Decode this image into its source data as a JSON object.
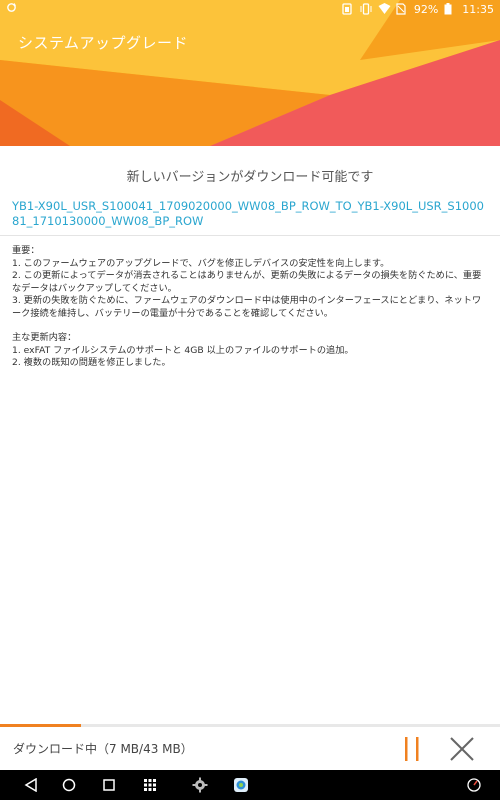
{
  "status_bar": {
    "battery_percent": "92%",
    "time": "11:35",
    "icons": [
      "sync-icon",
      "battery-saver-icon",
      "vibrate-icon",
      "wifi-icon",
      "no-sim-icon",
      "battery-icon"
    ]
  },
  "header": {
    "title": "システムアップグレード",
    "colors": {
      "orange": "#f7941d",
      "yellow": "#fdb813",
      "pink": "#f15a5a",
      "dark_orange": "#f06a22"
    }
  },
  "content": {
    "headline": "新しいバージョンがダウンロード可能です",
    "version_name": "YB1-X90L_USR_S100041_1709020000_WW08_BP_ROW_TO_YB1-X90L_USR_S100081_1710130000_WW08_BP_ROW",
    "notes": {
      "important_title": "重要：",
      "important_items": [
        "1. このファームウェアのアップグレードで、バグを修正しデバイスの安定性を向上します。",
        "2. この更新によってデータが消去されることはありませんが、更新の失敗によるデータの損失を防ぐために、重要なデータはバックアップしてください。",
        "3. 更新の失敗を防ぐために、ファームウェアのダウンロード中は使用中のインターフェースにとどまり、ネットワーク接続を維持し、バッテリーの電量が十分であることを確認してください。"
      ],
      "updates_title": "主な更新内容：",
      "update_items": [
        "1. exFAT ファイルシステムのサポートと 4GB 以上のファイルのサポートの追加。",
        "2. 複数の既知の問題を修正しました。"
      ]
    }
  },
  "download": {
    "status_text": "ダウンロード中（7 MB/43 MB）",
    "progress_fraction": 0.163,
    "accent_color": "#f08120",
    "pause_icon": "pause-icon",
    "cancel_icon": "close-icon"
  },
  "nav_bar": {
    "items": [
      "back-icon",
      "home-icon",
      "recents-icon",
      "app-drawer-icon",
      "settings-icon",
      "browser-icon",
      "performance-icon"
    ]
  }
}
